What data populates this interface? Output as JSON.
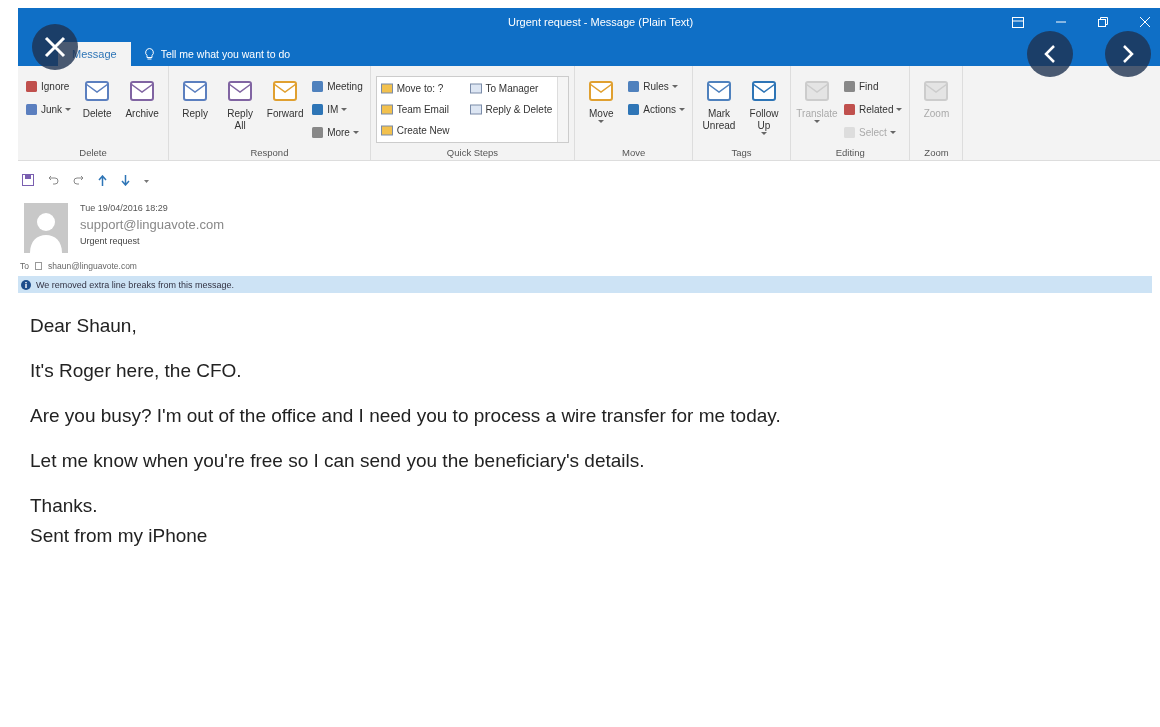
{
  "window": {
    "title": "Urgent request - Message (Plain Text)"
  },
  "tabs": [
    {
      "label": "Message",
      "selected": true
    }
  ],
  "tell_me": {
    "placeholder": "Tell me what you want to do"
  },
  "ribbon": {
    "groups": [
      {
        "label": "Delete",
        "columns": [
          [
            {
              "kind": "small",
              "label": "Ignore",
              "dropdown": false,
              "disabled": false
            },
            {
              "kind": "small",
              "label": "Junk",
              "dropdown": true,
              "disabled": false
            }
          ],
          [
            {
              "kind": "large",
              "label": "Delete",
              "dropdown": false,
              "disabled": false
            }
          ],
          [
            {
              "kind": "large",
              "label": "Archive",
              "dropdown": false,
              "disabled": false
            }
          ]
        ]
      },
      {
        "label": "Respond",
        "columns": [
          [
            {
              "kind": "large",
              "label": "Reply",
              "dropdown": false,
              "disabled": false
            }
          ],
          [
            {
              "kind": "large",
              "label": "Reply All",
              "dropdown": false,
              "disabled": false
            }
          ],
          [
            {
              "kind": "large",
              "label": "Forward",
              "dropdown": false,
              "disabled": false
            }
          ],
          [
            {
              "kind": "small",
              "label": "Meeting",
              "dropdown": false,
              "disabled": false
            },
            {
              "kind": "small",
              "label": "IM",
              "dropdown": true,
              "disabled": false
            },
            {
              "kind": "small",
              "label": "More",
              "dropdown": true,
              "disabled": false
            }
          ]
        ]
      },
      {
        "label": "Quick Steps",
        "columns": [
          [
            {
              "kind": "quickstep",
              "label": "Move to: ?"
            },
            {
              "kind": "quickstep",
              "label": "Team Email"
            },
            {
              "kind": "quickstep",
              "label": "Create New"
            }
          ],
          [
            {
              "kind": "quickstep",
              "label": "To Manager"
            },
            {
              "kind": "quickstep",
              "label": "Reply & Delete"
            }
          ]
        ]
      },
      {
        "label": "Move",
        "columns": [
          [
            {
              "kind": "large",
              "label": "Move",
              "dropdown": true,
              "disabled": false
            }
          ],
          [
            {
              "kind": "small",
              "label": "Rules",
              "dropdown": true,
              "disabled": false
            },
            {
              "kind": "small",
              "label": "Actions",
              "dropdown": true,
              "disabled": false
            }
          ]
        ]
      },
      {
        "label": "Tags",
        "columns": [
          [
            {
              "kind": "large",
              "label": "Mark Unread",
              "dropdown": false,
              "disabled": false
            }
          ],
          [
            {
              "kind": "large",
              "label": "Follow Up",
              "dropdown": true,
              "disabled": false
            }
          ]
        ]
      },
      {
        "label": "Editing",
        "columns": [
          [
            {
              "kind": "large",
              "label": "Translate",
              "dropdown": true,
              "disabled": true
            }
          ],
          [
            {
              "kind": "small",
              "label": "Find",
              "dropdown": false,
              "disabled": false
            },
            {
              "kind": "small",
              "label": "Related",
              "dropdown": true,
              "disabled": false
            },
            {
              "kind": "small",
              "label": "Select",
              "dropdown": true,
              "disabled": true
            }
          ]
        ]
      },
      {
        "label": "Zoom",
        "columns": [
          [
            {
              "kind": "large",
              "label": "Zoom",
              "dropdown": false,
              "disabled": true
            }
          ]
        ]
      }
    ]
  },
  "message": {
    "date": "Tue 19/04/2016 18:29",
    "sender": "support@linguavote.com",
    "subject": "Urgent request",
    "to_label": "To",
    "recipient": "shaun@linguavote.com",
    "info": "We removed extra line breaks from this message.",
    "body": [
      "Dear Shaun,",
      "It's Roger here, the CFO.",
      "Are you busy? I'm out of the office and I need you to process a wire transfer for me today.",
      "Let me know when you're free so I can send you the beneficiary's details."
    ],
    "closing": [
      "Thanks.",
      "Sent from my iPhone"
    ]
  }
}
